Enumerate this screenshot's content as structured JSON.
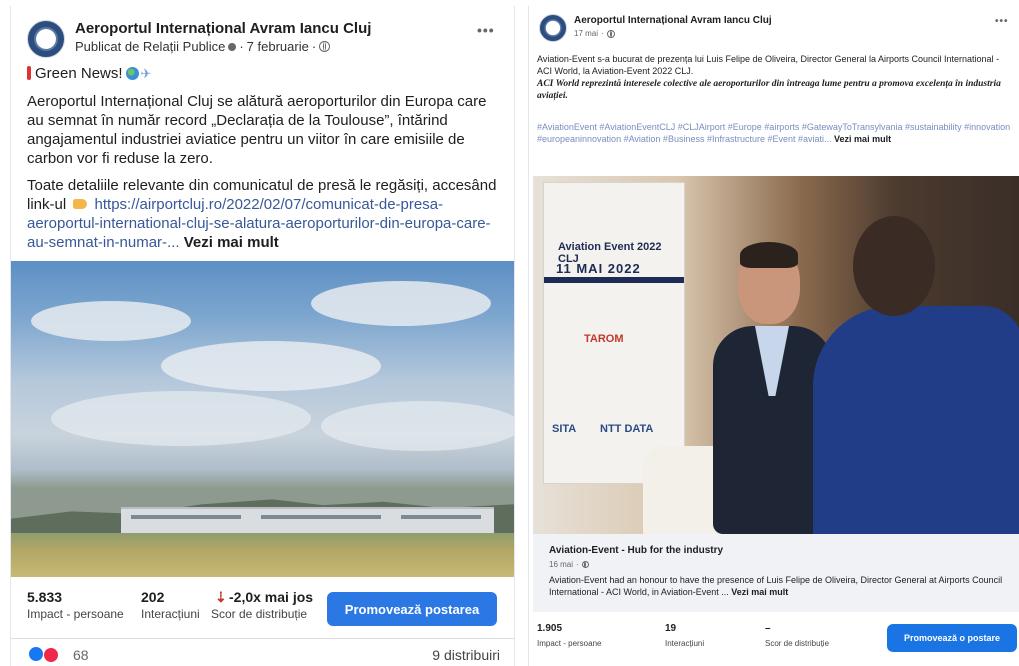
{
  "left_post": {
    "page_name": "Aeroportul Internațional Avram Iancu Cluj",
    "published_by": "Publicat de Relații Publice",
    "date": "7 februarie",
    "header_line": "Green News!",
    "paragraph1": "Aeroportul Internațional Cluj se alătură aeroporturilor din Europa care au semnat în număr record „Declarația de la Toulouse”, întărind angajamentul industriei aviatice pentru un viitor în care emisiile de carbon vor fi reduse la zero.",
    "paragraph2_text": "Toate detaliile relevante din comunicatul de presă le regăsiți, accesând link-ul",
    "paragraph2_link": "https://airportcluj.ro/2022/02/07/comunicat-de-presa-aeroportul-international-cluj-se-alatura-aeroporturilor-din-europa-care-au-semnat-in-numar-...",
    "see_more": "Vezi mai mult",
    "stats": {
      "impact_value": "5.833",
      "impact_label": "Impact - persoane",
      "interactions_value": "202",
      "interactions_label": "Interacțiuni",
      "distribution_value": "-2,0x mai jos",
      "distribution_label": "Scor de distribuție"
    },
    "promote_label": "Promovează postarea",
    "reactions_count": "68",
    "shares": "9 distribuiri"
  },
  "right_post": {
    "page_name": "Aeroportul Internațional Avram Iancu Cluj",
    "date": "17 mai",
    "paragraph1": "Aviation-Event s-a bucurat de prezența lui Luis Felipe de Oliveira, Director General la Airports Council International - ACI World, la Aviation-Event 2022 CLJ.",
    "paragraph2": "ACI World reprezintă interesele colective ale aeroporturilor din întreaga lume pentru a promova excelența în industria aviației.",
    "hashtags": "#AviationEvent #AviationEventCLJ #CLJAirport #Europe #airports #GatewayToTransylvania #sustainability #innovation #europeaninnovation #Aviation #Business #Infrastructure #Event #aviati...",
    "see_more": "Vezi mai mult",
    "banner_title": "Aviation Event 2022 CLJ",
    "banner_date": "11 MAI 2022",
    "banner_logos": [
      "TAROM",
      "SITA",
      "NTT DATA"
    ],
    "link_preview": {
      "title": "Aviation-Event - Hub for the industry",
      "date": "16 mai",
      "description": "Aviation-Event had an honour to have the presence of Luis Felipe de Oliveira, Director General at Airports Council International - ACI World, in Aviation-Event ...",
      "see_more": "Vezi mai mult"
    },
    "stats": {
      "impact_value": "1.905",
      "impact_label": "Impact - persoane",
      "interactions_value": "19",
      "interactions_label": "Interacțiuni",
      "distribution_value": "–",
      "distribution_label": "Scor de distribuție"
    },
    "promote_label": "Promovează o postare"
  },
  "icons": {
    "avatar": "airport-logo",
    "privacy": "globe-icon",
    "more": "more-options-icon",
    "reactions": [
      "like-reaction-icon",
      "love-reaction-icon"
    ]
  },
  "colors": {
    "promote_button": "#1b74e4",
    "link": "#385898",
    "hashtag": "#7b8cc1",
    "like": "#1877f2",
    "love": "#f02849"
  }
}
